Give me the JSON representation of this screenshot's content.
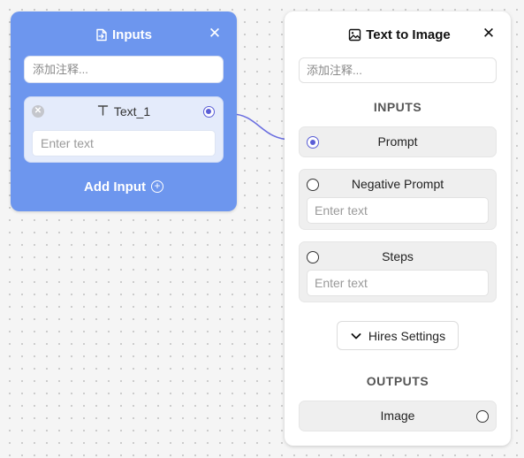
{
  "inputs_node": {
    "title": "Inputs",
    "comment_placeholder": "添加注释...",
    "input_item": {
      "label": "Text_1",
      "placeholder": "Enter text"
    },
    "add_input_label": "Add Input"
  },
  "t2i_node": {
    "title": "Text to Image",
    "comment_placeholder": "添加注释...",
    "inputs_heading": "INPUTS",
    "params": [
      {
        "label": "Prompt"
      },
      {
        "label": "Negative Prompt",
        "placeholder": "Enter text"
      },
      {
        "label": "Steps",
        "placeholder": "Enter text"
      }
    ],
    "hires_label": "Hires Settings",
    "outputs_heading": "OUTPUTS",
    "outputs": [
      {
        "label": "Image"
      }
    ]
  },
  "colors": {
    "inputs_node_bg": "#6d96ee",
    "accent": "#5a5ed6",
    "edge": "#6a6ee0"
  }
}
